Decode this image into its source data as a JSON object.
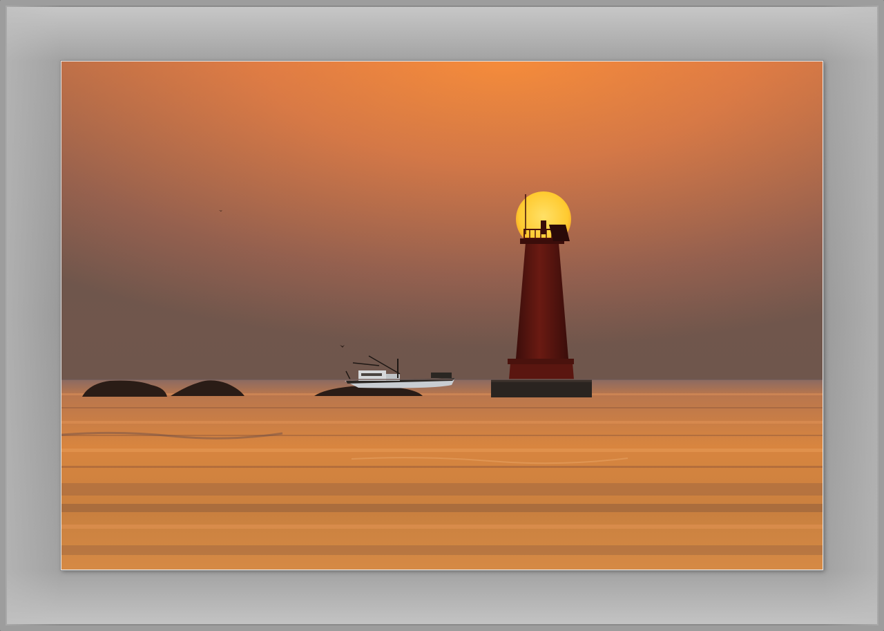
{
  "scene": {
    "subject": "lighthouse",
    "colors": {
      "sky_top": "#f28a3c",
      "sky_mid": "#b86a4f",
      "sky_horizon": "#76574f",
      "sun": "#ffd23a",
      "sea": "#d9803f",
      "silhouette": "#1e1410",
      "lighthouse": "#5a1610"
    }
  }
}
